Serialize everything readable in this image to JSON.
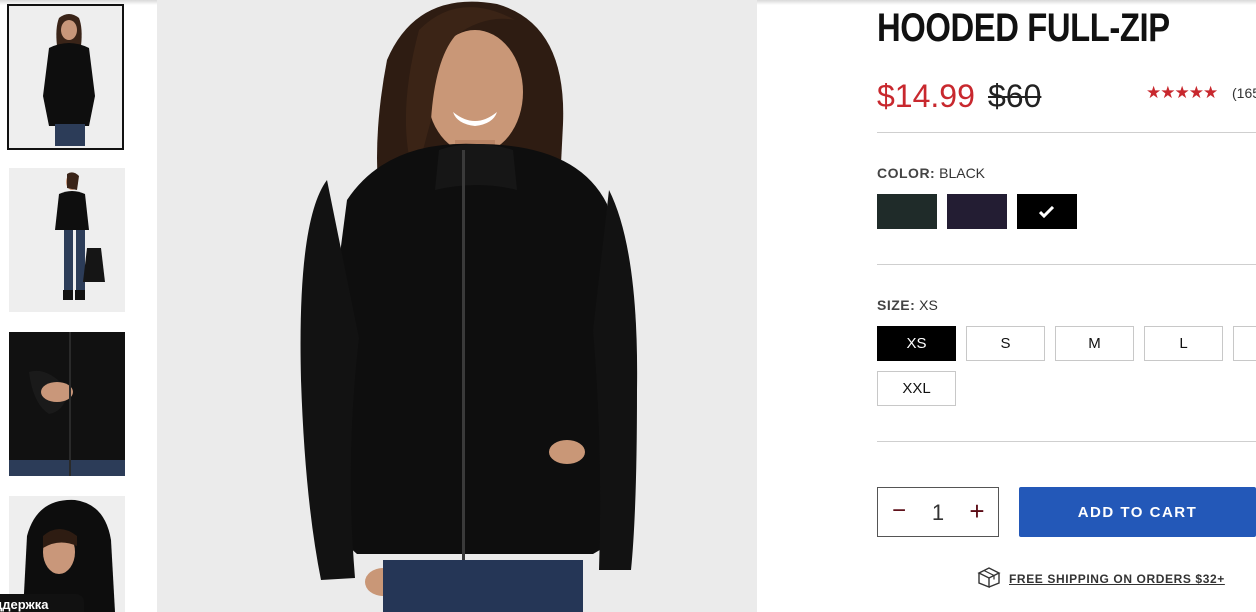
{
  "product": {
    "title": "HOODED FULL-ZIP",
    "price": "$14.99",
    "original_price": "$60",
    "stars": "★★★★★",
    "review_count": "(165"
  },
  "color": {
    "label": "COLOR:",
    "value": "BLACK",
    "swatches": [
      {
        "name": "dark-green",
        "hex": "#1f2b29"
      },
      {
        "name": "dark-purple",
        "hex": "#231d33"
      },
      {
        "name": "black",
        "hex": "#000000",
        "selected": true
      }
    ]
  },
  "size": {
    "label": "SIZE:",
    "value": "XS",
    "options": [
      "XS",
      "S",
      "M",
      "L",
      "",
      "XXL"
    ]
  },
  "quantity": {
    "minus": "−",
    "value": "1",
    "plus": "+"
  },
  "actions": {
    "add_to_cart": "ADD TO CART",
    "shipping": "FREE SHIPPING ON ORDERS $32+"
  },
  "chat_widget": {
    "label": "ддержка"
  },
  "colors": {
    "accent_red": "#c8282e",
    "button_blue": "#2358b8"
  }
}
